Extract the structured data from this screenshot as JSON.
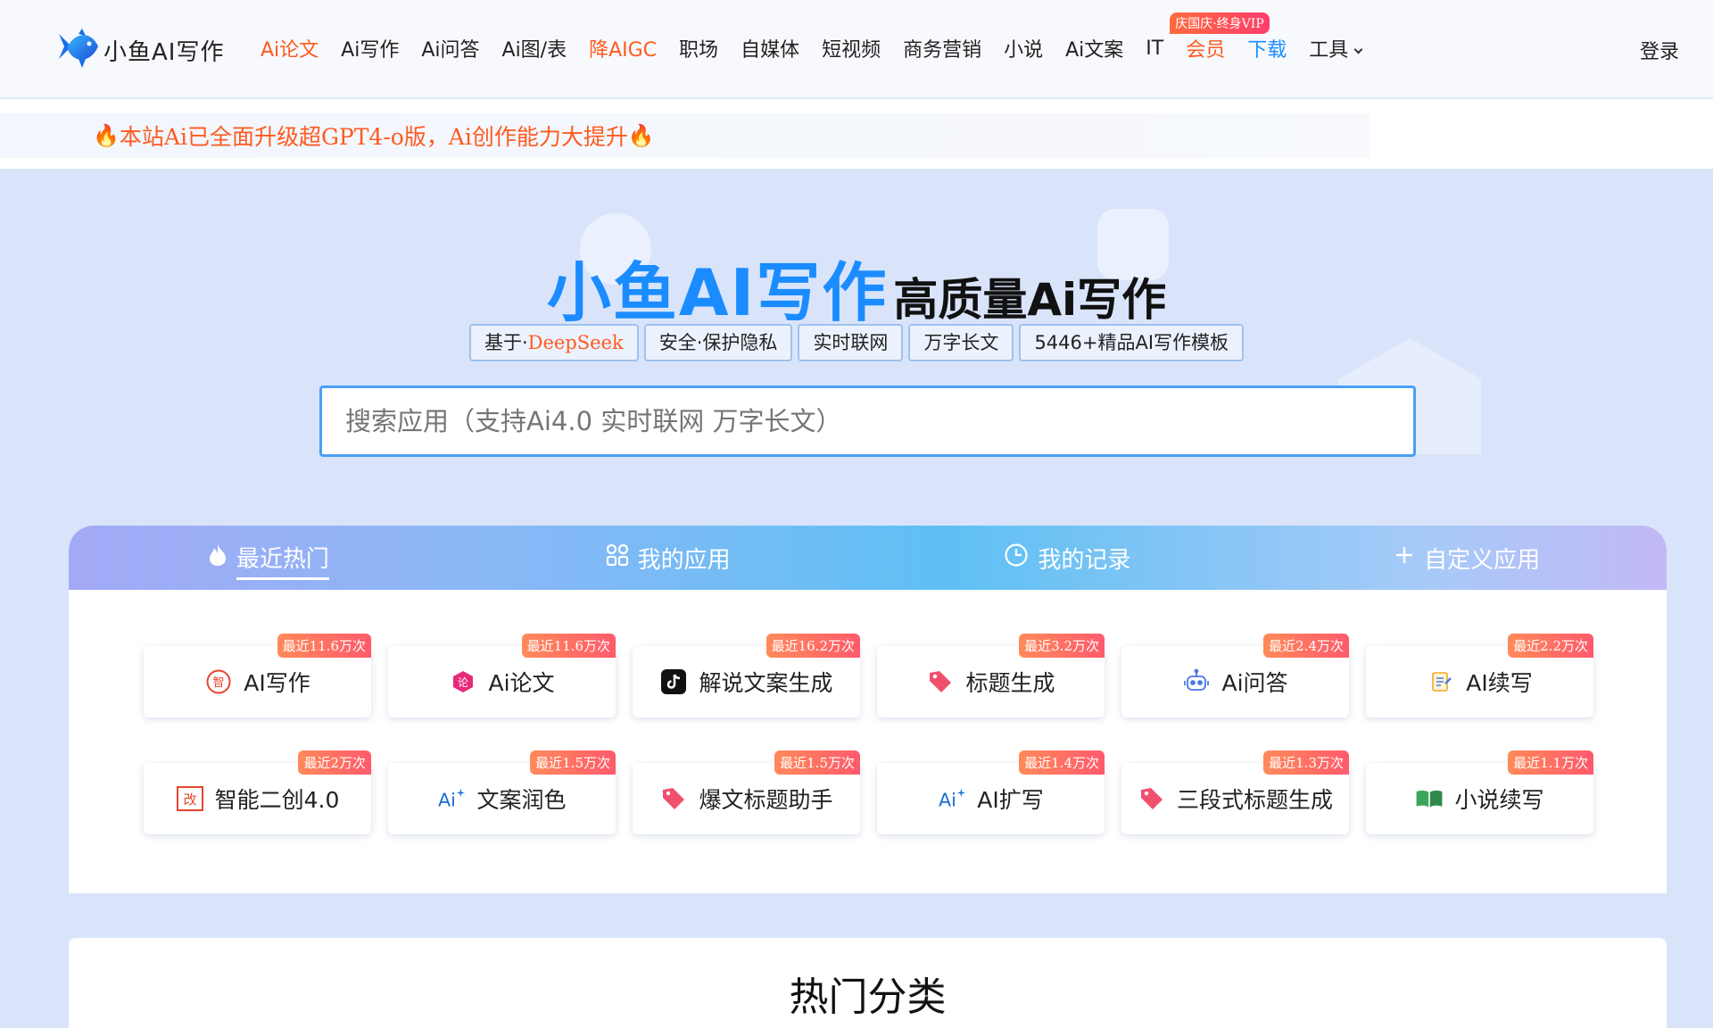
{
  "header": {
    "logo_text": "小鱼AI写作",
    "nav": [
      {
        "label": "Ai论文",
        "style": "accent"
      },
      {
        "label": "Ai写作",
        "style": ""
      },
      {
        "label": "Ai问答",
        "style": ""
      },
      {
        "label": "Ai图/表",
        "style": ""
      },
      {
        "label": "降AIGC",
        "style": "accent"
      },
      {
        "label": "职场",
        "style": ""
      },
      {
        "label": "自媒体",
        "style": ""
      },
      {
        "label": "短视频",
        "style": ""
      },
      {
        "label": "商务营销",
        "style": ""
      },
      {
        "label": "小说",
        "style": ""
      },
      {
        "label": "Ai文案",
        "style": ""
      },
      {
        "label": "IT",
        "style": ""
      },
      {
        "label": "会员",
        "style": "accent",
        "badge": "庆国庆·终身VIP"
      },
      {
        "label": "下载",
        "style": "blue"
      },
      {
        "label": "工具",
        "style": "",
        "dropdown": true
      }
    ],
    "login": "登录"
  },
  "notice": {
    "text": "本站Ai已全面升级超GPT4-o版，Ai创作能力大提升"
  },
  "hero": {
    "title_main": "小鱼AI写作",
    "title_sub": "高质量Ai写作",
    "tags": [
      {
        "prefix": "基于·",
        "highlight": "DeepSeek"
      },
      {
        "prefix": "安全·保护隐私",
        "highlight": ""
      },
      {
        "prefix": "实时联网",
        "highlight": ""
      },
      {
        "prefix": "万字长文",
        "highlight": ""
      },
      {
        "prefix": "5446+精品AI写作模板",
        "highlight": ""
      }
    ],
    "search_placeholder": "搜索应用（支持Ai4.0 实时联网 万字长文）"
  },
  "tabs": [
    {
      "label": "最近热门",
      "icon": "flame-icon",
      "active": true
    },
    {
      "label": "我的应用",
      "icon": "apps-icon",
      "active": false
    },
    {
      "label": "我的记录",
      "icon": "clock-icon",
      "active": false
    },
    {
      "label": "自定义应用",
      "icon": "plus-icon",
      "active": false
    }
  ],
  "apps": [
    {
      "label": "AI写作",
      "badge": "最近11.6万次",
      "icon": "zhi-icon",
      "color": "#e8452c"
    },
    {
      "label": "Ai论文",
      "badge": "最近11.6万次",
      "icon": "lun-icon",
      "color": "#e8297a"
    },
    {
      "label": "解说文案生成",
      "badge": "最近16.2万次",
      "icon": "tiktok-icon",
      "color": "#111111"
    },
    {
      "label": "标题生成",
      "badge": "最近3.2万次",
      "icon": "tag-icon",
      "color": "#f0506e"
    },
    {
      "label": "Ai问答",
      "badge": "最近2.4万次",
      "icon": "robot-icon",
      "color": "#4a78e8"
    },
    {
      "label": "AI续写",
      "badge": "最近2.2万次",
      "icon": "notepad-icon",
      "color": "#f5a623"
    },
    {
      "label": "智能二创4.0",
      "badge": "最近2万次",
      "icon": "gai-icon",
      "color": "#e8452c"
    },
    {
      "label": "文案润色",
      "badge": "最近1.5万次",
      "icon": "ai-sparkle-icon",
      "color": "#1a6fd6"
    },
    {
      "label": "爆文标题助手",
      "badge": "最近1.5万次",
      "icon": "tag-icon",
      "color": "#f0506e"
    },
    {
      "label": "AI扩写",
      "badge": "最近1.4万次",
      "icon": "ai-sparkle-icon",
      "color": "#1a6fd6"
    },
    {
      "label": "三段式标题生成",
      "badge": "最近1.3万次",
      "icon": "tag-icon",
      "color": "#f0506e"
    },
    {
      "label": "小说续写",
      "badge": "最近1.1万次",
      "icon": "book-icon",
      "color": "#3aa65a"
    }
  ],
  "hot": {
    "title": "热门分类"
  }
}
